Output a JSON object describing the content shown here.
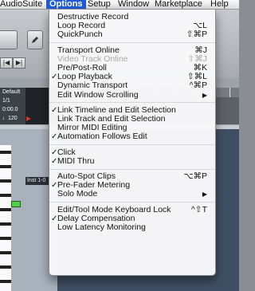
{
  "menubar": {
    "items": [
      {
        "label": "AudioSuite",
        "active": false
      },
      {
        "label": "Options",
        "active": true
      },
      {
        "label": "Setup",
        "active": false
      },
      {
        "label": "Window",
        "active": false
      },
      {
        "label": "Marketplace",
        "active": false
      },
      {
        "label": "Help",
        "active": false
      }
    ]
  },
  "background": {
    "toolbar_icon": "pencil-icon",
    "ruler_labels": [
      "Default",
      "1/1",
      "0:00.0",
      "♩120"
    ],
    "ruler_values": [
      "",
      "",
      "",
      ""
    ],
    "track_name": "Inst 1-0",
    "transport_buttons": [
      "|◀",
      "▶|"
    ]
  },
  "menu": {
    "items": [
      {
        "label": "Destructive Record",
        "shortcut": "",
        "checked": false,
        "disabled": false,
        "submenu": false
      },
      {
        "label": "Loop Record",
        "shortcut": "⌥L",
        "checked": false,
        "disabled": false,
        "submenu": false
      },
      {
        "label": "QuickPunch",
        "shortcut": "⇧⌘P",
        "checked": false,
        "disabled": false,
        "submenu": false
      },
      {
        "sep": true
      },
      {
        "label": "Transport Online",
        "shortcut": "⌘J",
        "checked": false,
        "disabled": false,
        "submenu": false
      },
      {
        "label": "Video Track Online",
        "shortcut": "⇧⌘J",
        "checked": false,
        "disabled": true,
        "submenu": false
      },
      {
        "label": "Pre/Post-Roll",
        "shortcut": "⌘K",
        "checked": false,
        "disabled": false,
        "submenu": false
      },
      {
        "label": "Loop Playback",
        "shortcut": "⇧⌘L",
        "checked": true,
        "disabled": false,
        "submenu": false
      },
      {
        "label": "Dynamic Transport",
        "shortcut": "^⌘P",
        "checked": false,
        "disabled": false,
        "submenu": false
      },
      {
        "label": "Edit Window Scrolling",
        "shortcut": "",
        "checked": false,
        "disabled": false,
        "submenu": true
      },
      {
        "sep": true
      },
      {
        "label": "Link Timeline and Edit Selection",
        "shortcut": "",
        "checked": true,
        "disabled": false,
        "submenu": false
      },
      {
        "label": "Link Track and Edit Selection",
        "shortcut": "",
        "checked": false,
        "disabled": false,
        "submenu": false
      },
      {
        "label": "Mirror MIDI Editing",
        "shortcut": "",
        "checked": false,
        "disabled": false,
        "submenu": false
      },
      {
        "label": "Automation Follows Edit",
        "shortcut": "",
        "checked": true,
        "disabled": false,
        "submenu": false
      },
      {
        "sep": true
      },
      {
        "label": "Click",
        "shortcut": "",
        "checked": true,
        "disabled": false,
        "submenu": false
      },
      {
        "label": "MIDI Thru",
        "shortcut": "",
        "checked": true,
        "disabled": false,
        "submenu": false
      },
      {
        "sep": true
      },
      {
        "label": "Auto-Spot Clips",
        "shortcut": "⌥⌘P",
        "checked": false,
        "disabled": false,
        "submenu": false
      },
      {
        "label": "Pre-Fader Metering",
        "shortcut": "",
        "checked": true,
        "disabled": false,
        "submenu": false
      },
      {
        "label": "Solo Mode",
        "shortcut": "",
        "checked": false,
        "disabled": false,
        "submenu": true
      },
      {
        "sep": true
      },
      {
        "label": "Edit/Tool Mode Keyboard Lock",
        "shortcut": "^⇧T",
        "checked": false,
        "disabled": false,
        "submenu": false
      },
      {
        "label": "Delay Compensation",
        "shortcut": "",
        "checked": true,
        "disabled": false,
        "submenu": false
      },
      {
        "label": "Low Latency Monitoring",
        "shortcut": "",
        "checked": false,
        "disabled": false,
        "submenu": false
      }
    ],
    "check_glyph": "✓",
    "submenu_glyph": "▶"
  }
}
